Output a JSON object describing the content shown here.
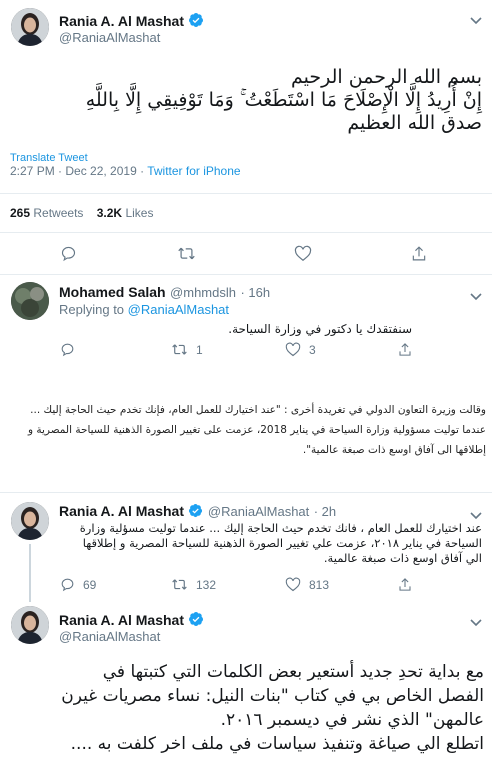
{
  "main_tweet": {
    "name": "Rania A. Al Mashat",
    "handle": "@RaniaAlMashat",
    "text_lines": [
      "بسم الله الرحمن الرحيم",
      "إِنْ أُرِيدُ إِلَّا الْإِصْلَاحَ مَا اسْتَطَعْتُ ۚ وَمَا تَوْفِيقِي إِلَّا بِاللَّهِ",
      "صدق الله العظيم"
    ],
    "translate": "Translate Tweet",
    "time": "2:27 PM · Dec 22, 2019",
    "separator": " · ",
    "source": "Twitter for iPhone",
    "retweets_count": "265",
    "retweets_label": "Retweets",
    "likes_count": "3.2K",
    "likes_label": "Likes"
  },
  "reply_tweet": {
    "name": "Mohamed Salah",
    "handle": "@mhmdslh",
    "age": "· 16h",
    "replying_prefix": "Replying to",
    "replying_to": "@RaniaAlMashat",
    "text": "سنفتقدك يا دكتور في وزارة السياحة.",
    "retweets": "1",
    "likes": "3"
  },
  "quote_block": {
    "line1": "وقالت وزيرة التعاون الدولي في تغريدة أخرى : \"عند اختيارك للعمل العام، فإنك تخدم حيث الحاجة إليك ...",
    "line2": "عندما توليت مسؤولية وزارة السياحة في يناير 2018، عزمت على تغيير الصورة الذهنية للسياحة المصرية و",
    "line3": "إطلاقها الى آفاق اوسع ذات صبغة عالمية\"."
  },
  "thread_tweet": {
    "name": "Rania A. Al Mashat",
    "handle": "@RaniaAlMashat",
    "age": "· 2h",
    "text_lines": [
      "عند اختيارك للعمل العام ، فانك تخدم حيث الحاجة إليك ... عندما توليت مسؤلية وزارة",
      "السياحة في يناير ٢٠١٨، عزمت علي تغيير الصورة الذهنية للسياحة المصرية و إطلاقها",
      "الي آفاق اوسع ذات صبغة عالمية."
    ],
    "replies": "69",
    "retweets": "132",
    "likes": "813"
  },
  "last_tweet": {
    "name": "Rania A. Al Mashat",
    "handle": "@RaniaAlMashat",
    "text_lines": [
      "مع بداية تحدِ جديد أستعير بعض الكلمات التي كتبتها في",
      "الفصل الخاص بي في كتاب \"بنات النيل: نساء مصريات غيرن",
      "عالمهن\" الذي نشر في ديسمبر ٢٠١٦.",
      "اتطلع الي صياغة وتنفيذ سياسات في ملف اخر كلفت به ...."
    ]
  },
  "colors": {
    "accent": "#1b95e0",
    "verified": "#1da1f2",
    "muted": "#657786",
    "divider": "#e6ecf0"
  }
}
